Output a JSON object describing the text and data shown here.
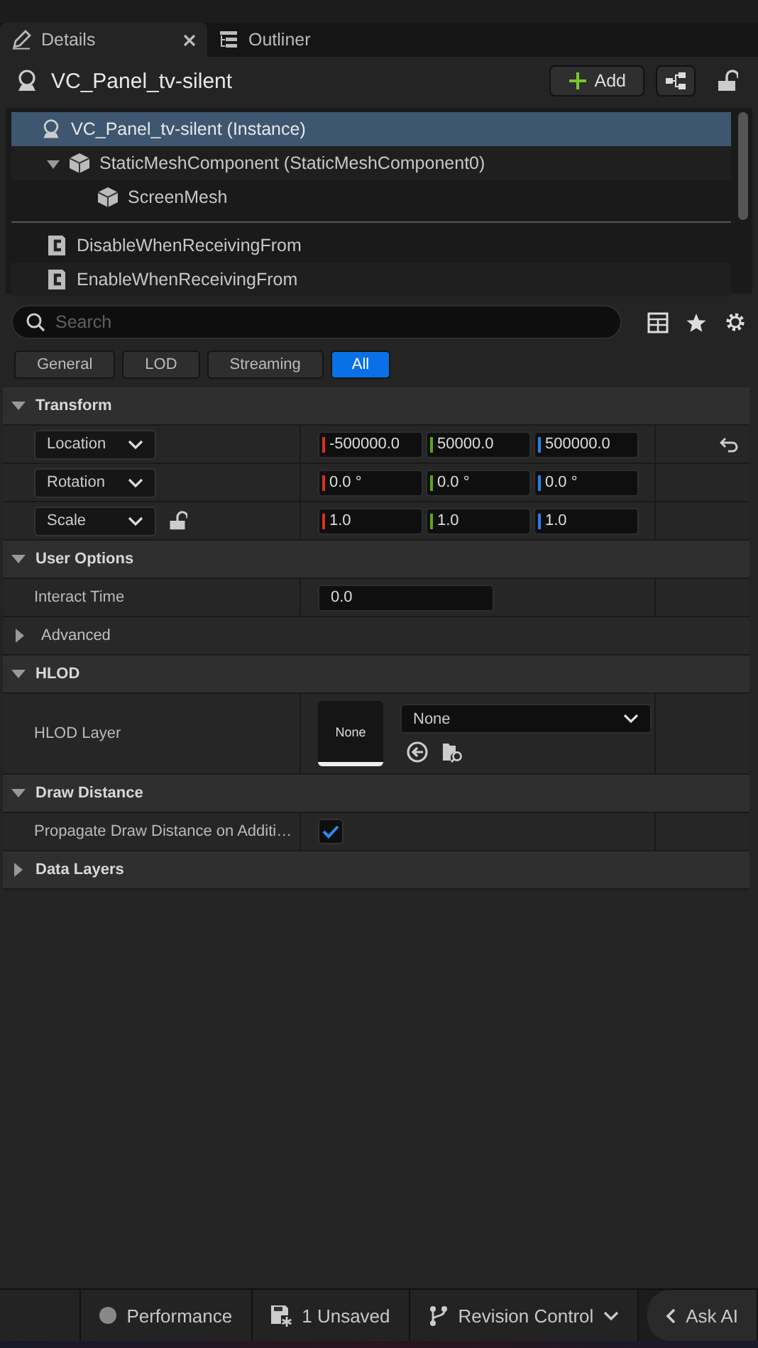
{
  "tabs": [
    {
      "label": "Details",
      "selected": true,
      "closable": true,
      "kind": "details"
    },
    {
      "label": "Outliner",
      "selected": false,
      "closable": false,
      "kind": "outliner"
    }
  ],
  "header": {
    "title": "VC_Panel_tv-silent",
    "add_label": "Add",
    "locked": false
  },
  "tree": {
    "items": [
      {
        "label": "VC_Panel_tv-silent (Instance)",
        "kind": "actor",
        "selected": true,
        "children": [
          {
            "label": "StaticMeshComponent (StaticMeshComponent0)",
            "kind": "mesh",
            "selected": false,
            "expanded": true,
            "children": [
              {
                "label": "ScreenMesh",
                "kind": "mesh",
                "selected": false
              }
            ]
          }
        ]
      }
    ],
    "variables": [
      {
        "label": "DisableWhenReceivingFrom",
        "kind": "script"
      },
      {
        "label": "EnableWhenReceivingFrom",
        "kind": "script"
      }
    ]
  },
  "search": {
    "placeholder": "Search"
  },
  "filters": [
    {
      "label": "General",
      "selected": false
    },
    {
      "label": "LOD",
      "selected": false
    },
    {
      "label": "Streaming",
      "selected": false
    },
    {
      "label": "All",
      "selected": true
    }
  ],
  "sections": [
    {
      "title": "Transform",
      "expanded": true,
      "rows": [
        {
          "kind": "vector",
          "label": "Location",
          "resettable": true,
          "values": [
            {
              "text": "-500000.0",
              "color": "#d8321e"
            },
            {
              "text": "50000.0",
              "color": "#5fa51c"
            },
            {
              "text": "500000.0",
              "color": "#2a7fe8"
            }
          ]
        },
        {
          "kind": "vector",
          "label": "Rotation",
          "values": [
            {
              "text": "0.0 °",
              "color": "#d8321e"
            },
            {
              "text": "0.0 °",
              "color": "#5fa51c"
            },
            {
              "text": "0.0 °",
              "color": "#2a7fe8"
            }
          ]
        },
        {
          "kind": "vector",
          "label": "Scale",
          "lock": true,
          "values": [
            {
              "text": "1.0",
              "color": "#d8321e"
            },
            {
              "text": "1.0",
              "color": "#5fa51c"
            },
            {
              "text": "1.0",
              "color": "#2a7fe8"
            }
          ]
        }
      ]
    },
    {
      "title": "User Options",
      "expanded": true,
      "rows": [
        {
          "kind": "number",
          "label": "Interact Time",
          "value": "0.0"
        },
        {
          "kind": "group",
          "label": "Advanced",
          "expanded": false
        }
      ]
    },
    {
      "title": "HLOD",
      "expanded": true,
      "rows": [
        {
          "kind": "asset",
          "label": "HLOD Layer",
          "thumb": "None",
          "value": "None"
        }
      ]
    },
    {
      "title": "Draw Distance",
      "expanded": true,
      "rows": [
        {
          "kind": "checkbox",
          "label": "Propagate Draw Distance on Additi…",
          "checked": true
        }
      ]
    },
    {
      "title": "Data Layers",
      "expanded": false
    }
  ],
  "status_bar": [
    {
      "label": "Performance",
      "kind": "performance"
    },
    {
      "label": "1 Unsaved",
      "kind": "unsaved"
    },
    {
      "label": "Revision Control",
      "kind": "revision"
    },
    {
      "label": "Ask AI",
      "kind": "ask"
    }
  ]
}
